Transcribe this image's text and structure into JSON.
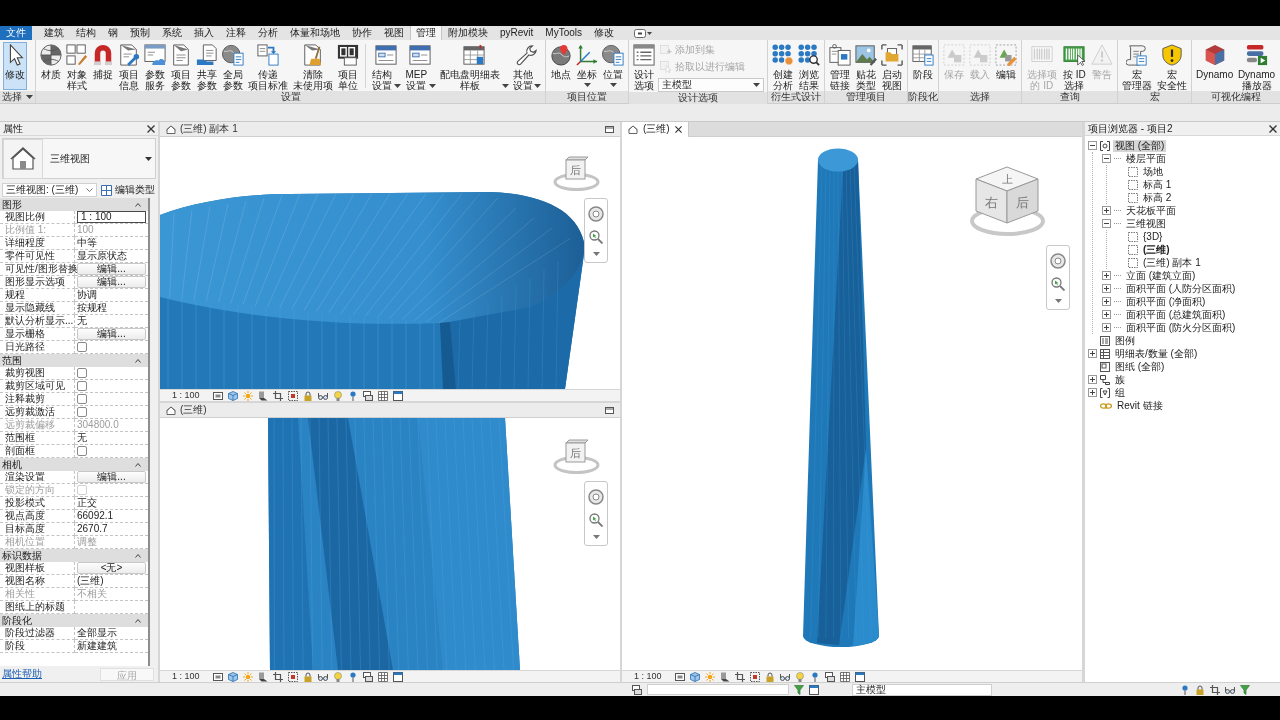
{
  "ribbon": {
    "tabs": [
      {
        "label": "文件",
        "kind": "file",
        "selected": false
      },
      {
        "label": "建筑",
        "kind": "tab",
        "selected": false
      },
      {
        "label": "结构",
        "kind": "tab",
        "selected": false
      },
      {
        "label": "钢",
        "kind": "tab",
        "selected": false
      },
      {
        "label": "预制",
        "kind": "tab",
        "selected": false
      },
      {
        "label": "系统",
        "kind": "tab",
        "selected": false
      },
      {
        "label": "插入",
        "kind": "tab",
        "selected": false
      },
      {
        "label": "注释",
        "kind": "tab",
        "selected": false
      },
      {
        "label": "分析",
        "kind": "tab",
        "selected": false
      },
      {
        "label": "体量和场地",
        "kind": "tab",
        "selected": false
      },
      {
        "label": "协作",
        "kind": "tab",
        "selected": false
      },
      {
        "label": "视图",
        "kind": "tab",
        "selected": false
      },
      {
        "label": "管理",
        "kind": "tab",
        "selected": true
      },
      {
        "label": "附加模块",
        "kind": "tab",
        "selected": false
      },
      {
        "label": "pyRevit",
        "kind": "tab",
        "selected": false
      },
      {
        "label": "MyTools",
        "kind": "tab",
        "selected": false
      },
      {
        "label": "修改",
        "kind": "tab",
        "selected": false
      }
    ],
    "panels": [
      {
        "label": "选择",
        "dropdown": true,
        "items": [
          {
            "label": "修改",
            "kind": "large",
            "active": true,
            "disabled": false
          }
        ]
      },
      {
        "label": "设置",
        "dropdown": false,
        "items": [
          {
            "label": "材质",
            "kind": "large",
            "active": false,
            "disabled": false
          },
          {
            "label": "对象样式",
            "kind": "large",
            "active": false,
            "disabled": false
          },
          {
            "label": "捕捉",
            "kind": "large",
            "active": false,
            "disabled": false
          },
          {
            "label": "项目信息",
            "kind": "large",
            "active": false,
            "disabled": false
          },
          {
            "label": "参数服务",
            "kind": "large",
            "active": false,
            "disabled": false
          },
          {
            "label": "项目参数",
            "kind": "large",
            "active": false,
            "disabled": false
          },
          {
            "label": "共享参数",
            "kind": "large",
            "active": false,
            "disabled": false
          },
          {
            "label": "全局参数",
            "kind": "large",
            "active": false,
            "disabled": false
          },
          {
            "label": "传递项目标准",
            "kind": "large",
            "active": false,
            "disabled": false
          },
          {
            "label": "清除未使用项",
            "kind": "large",
            "active": false,
            "disabled": false
          },
          {
            "label": "项目单位",
            "kind": "large",
            "active": false,
            "disabled": false
          },
          {
            "kind": "separator"
          },
          {
            "label": "结构设置",
            "kind": "menu",
            "active": false,
            "disabled": false
          },
          {
            "label": "MEP设置",
            "kind": "menu",
            "active": false,
            "disabled": false
          },
          {
            "label": "配电盘明细表样板",
            "kind": "menu",
            "active": false,
            "disabled": false
          },
          {
            "label": "其他设置",
            "kind": "menu",
            "active": false,
            "disabled": false
          }
        ]
      },
      {
        "label": "项目位置",
        "dropdown": false,
        "items": [
          {
            "label": "地点",
            "kind": "large",
            "active": false,
            "disabled": false
          },
          {
            "label": "坐标",
            "kind": "menu",
            "active": false,
            "disabled": false
          },
          {
            "label": "位置",
            "kind": "menu",
            "active": false,
            "disabled": false
          }
        ]
      },
      {
        "label": "设计选项",
        "dropdown": false,
        "items": [
          {
            "label": "设计选项",
            "kind": "large",
            "active": false,
            "disabled": false
          },
          {
            "label": "添加到集",
            "kind": "small",
            "disabled": true
          },
          {
            "label": "拾取以进行编辑",
            "kind": "small",
            "disabled": true
          },
          {
            "label": "主模型",
            "kind": "combo",
            "disabled": false
          }
        ]
      },
      {
        "label": "衍生式设计",
        "dropdown": false,
        "items": [
          {
            "label": "创建分析",
            "kind": "large",
            "active": false,
            "disabled": false
          },
          {
            "label": "浏览结果",
            "kind": "large",
            "active": false,
            "disabled": false
          }
        ]
      },
      {
        "label": "管理项目",
        "dropdown": false,
        "items": [
          {
            "label": "管理链接",
            "kind": "large",
            "active": false,
            "disabled": false
          },
          {
            "label": "贴花类型",
            "kind": "large",
            "active": false,
            "disabled": false
          },
          {
            "label": "启动视图",
            "kind": "large",
            "active": false,
            "disabled": false
          }
        ]
      },
      {
        "label": "阶段化",
        "dropdown": false,
        "items": [
          {
            "label": "阶段",
            "kind": "large",
            "active": false,
            "disabled": false
          }
        ]
      },
      {
        "label": "选择",
        "dropdown": false,
        "items": [
          {
            "label": "保存",
            "kind": "large",
            "active": false,
            "disabled": true
          },
          {
            "label": "载入",
            "kind": "large",
            "active": false,
            "disabled": true
          },
          {
            "label": "编辑",
            "kind": "large",
            "active": false,
            "disabled": false
          }
        ]
      },
      {
        "label": "查询",
        "dropdown": false,
        "items": [
          {
            "label": "选择项的 ID",
            "kind": "large",
            "active": false,
            "disabled": true
          },
          {
            "label": "按 ID选择",
            "kind": "large",
            "active": false,
            "disabled": false
          },
          {
            "label": "警告",
            "kind": "large",
            "active": false,
            "disabled": true
          }
        ]
      },
      {
        "label": "宏",
        "dropdown": false,
        "items": [
          {
            "label": "宏管理器",
            "kind": "large",
            "active": false,
            "disabled": false
          },
          {
            "label": "宏安全性",
            "kind": "large",
            "active": false,
            "disabled": false
          }
        ]
      },
      {
        "label": "可视化编程",
        "dropdown": false,
        "items": [
          {
            "label": "Dynamo",
            "kind": "large",
            "active": false,
            "disabled": false
          },
          {
            "label": "Dynamo播放器",
            "kind": "large",
            "active": false,
            "disabled": false
          }
        ]
      }
    ]
  },
  "properties": {
    "title": "属性",
    "type_name": "三维视图",
    "instance": "三维视图: (三维)",
    "edit_type": "编辑类型",
    "groups": [
      {
        "label": "图形",
        "expanded": true,
        "rows": [
          {
            "name": "视图比例",
            "kind": "input",
            "value": "1 : 100",
            "disabled": false
          },
          {
            "name": "比例值 1:",
            "kind": "text",
            "value": "100",
            "disabled": true
          },
          {
            "name": "详细程度",
            "kind": "text",
            "value": "中等",
            "disabled": false
          },
          {
            "name": "零件可见性",
            "kind": "text",
            "value": "显示原状态",
            "disabled": false
          },
          {
            "name": "可见性/图形替换",
            "kind": "button",
            "value": "编辑...",
            "disabled": false
          },
          {
            "name": "图形显示选项",
            "kind": "button",
            "value": "编辑...",
            "disabled": false
          },
          {
            "name": "规程",
            "kind": "text",
            "value": "协调",
            "disabled": false
          },
          {
            "name": "显示隐藏线",
            "kind": "text",
            "value": "按规程",
            "disabled": false
          },
          {
            "name": "默认分析显示...",
            "kind": "text",
            "value": "无",
            "disabled": false
          },
          {
            "name": "显示栅格",
            "kind": "button",
            "value": "编辑...",
            "disabled": false
          },
          {
            "name": "日光路径",
            "kind": "checkbox",
            "checked": false,
            "disabled": false
          }
        ]
      },
      {
        "label": "范围",
        "expanded": true,
        "rows": [
          {
            "name": "裁剪视图",
            "kind": "checkbox",
            "checked": false,
            "disabled": false
          },
          {
            "name": "裁剪区域可见",
            "kind": "checkbox",
            "checked": false,
            "disabled": false
          },
          {
            "name": "注释裁剪",
            "kind": "checkbox",
            "checked": false,
            "disabled": false
          },
          {
            "name": "远剪裁激活",
            "kind": "checkbox",
            "checked": false,
            "disabled": false
          },
          {
            "name": "远剪裁偏移",
            "kind": "text",
            "value": "304800.0",
            "disabled": true
          },
          {
            "name": "范围框",
            "kind": "text",
            "value": "无",
            "disabled": false
          },
          {
            "name": "剖面框",
            "kind": "checkbox",
            "checked": false,
            "disabled": false
          }
        ]
      },
      {
        "label": "相机",
        "expanded": true,
        "rows": [
          {
            "name": "渲染设置",
            "kind": "button",
            "value": "编辑...",
            "disabled": false
          },
          {
            "name": "锁定的方向",
            "kind": "checkbox",
            "checked": false,
            "disabled": true
          },
          {
            "name": "投影模式",
            "kind": "text",
            "value": "正交",
            "disabled": false
          },
          {
            "name": "视点高度",
            "kind": "text",
            "value": "66092.1",
            "disabled": false
          },
          {
            "name": "目标高度",
            "kind": "text",
            "value": "2670.7",
            "disabled": false
          },
          {
            "name": "相机位置",
            "kind": "text",
            "value": "调整",
            "disabled": true
          }
        ]
      },
      {
        "label": "标识数据",
        "expanded": true,
        "rows": [
          {
            "name": "视图样板",
            "kind": "button",
            "value": "<无>",
            "disabled": false
          },
          {
            "name": "视图名称",
            "kind": "text",
            "value": "(三维)",
            "disabled": false
          },
          {
            "name": "相关性",
            "kind": "text",
            "value": "不相关",
            "disabled": true
          },
          {
            "name": "图纸上的标题",
            "kind": "text",
            "disabled": false
          }
        ]
      },
      {
        "label": "阶段化",
        "expanded": true,
        "rows": [
          {
            "name": "阶段过滤器",
            "kind": "text",
            "value": "全部显示",
            "disabled": false
          },
          {
            "name": "阶段",
            "kind": "text",
            "value": "新建建筑",
            "disabled": false
          }
        ]
      }
    ],
    "help_link": "属性帮助",
    "apply": {
      "label": "应用",
      "disabled": true
    }
  },
  "views": [
    {
      "title": "(三维) 副本 1",
      "selected": false,
      "scale": "1 : 100",
      "cube_labels": [
        "后"
      ]
    },
    {
      "title": "(三维)",
      "selected": false,
      "scale": "1 : 100",
      "cube_labels": [
        "后"
      ]
    },
    {
      "title": "(三维)",
      "selected": true,
      "scale": "1 : 100",
      "cube_labels": [
        "上",
        "右",
        "后"
      ]
    }
  ],
  "project_browser": {
    "title": "项目浏览器 - 项目2",
    "tree": [
      {
        "label": "视图 (全部)",
        "kind": "root",
        "expanded": true,
        "selected": true,
        "children": [
          {
            "label": "楼层平面",
            "kind": "category",
            "expanded": true,
            "selected": false,
            "children": [
              {
                "label": "场地",
                "kind": "view",
                "selected": false,
                "open": false
              },
              {
                "label": "标高 1",
                "kind": "view",
                "selected": false,
                "open": false
              },
              {
                "label": "标高 2",
                "kind": "view",
                "selected": false,
                "open": false
              }
            ]
          },
          {
            "label": "天花板平面",
            "kind": "category",
            "expanded": false,
            "selected": false
          },
          {
            "label": "三维视图",
            "kind": "category",
            "expanded": true,
            "selected": false,
            "children": [
              {
                "label": "{3D}",
                "kind": "view",
                "selected": false,
                "open": false
              },
              {
                "label": "(三维)",
                "kind": "view",
                "selected": false,
                "open": true
              },
              {
                "label": "(三维) 副本 1",
                "kind": "view",
                "selected": false,
                "open": false
              }
            ]
          },
          {
            "label": "立面 (建筑立面)",
            "kind": "category",
            "expanded": false,
            "selected": false
          },
          {
            "label": "面积平面 (人防分区面积)",
            "kind": "category",
            "expanded": false,
            "selected": false
          },
          {
            "label": "面积平面 (净面积)",
            "kind": "category",
            "expanded": false,
            "selected": false
          },
          {
            "label": "面积平面 (总建筑面积)",
            "kind": "category",
            "expanded": false,
            "selected": false
          },
          {
            "label": "面积平面 (防火分区面积)",
            "kind": "category",
            "expanded": false,
            "selected": false
          }
        ]
      },
      {
        "label": "图例",
        "kind": "legend",
        "selected": false
      },
      {
        "label": "明细表/数量 (全部)",
        "kind": "schedule",
        "expanded": false,
        "selected": false
      },
      {
        "label": "图纸 (全部)",
        "kind": "sheet",
        "selected": false
      },
      {
        "label": "族",
        "kind": "family",
        "expanded": false,
        "selected": false
      },
      {
        "label": "组",
        "kind": "group",
        "expanded": false,
        "selected": false
      },
      {
        "label": "Revit 链接",
        "kind": "link",
        "selected": false
      }
    ]
  },
  "status_bar": {
    "model_field": "主模型"
  }
}
